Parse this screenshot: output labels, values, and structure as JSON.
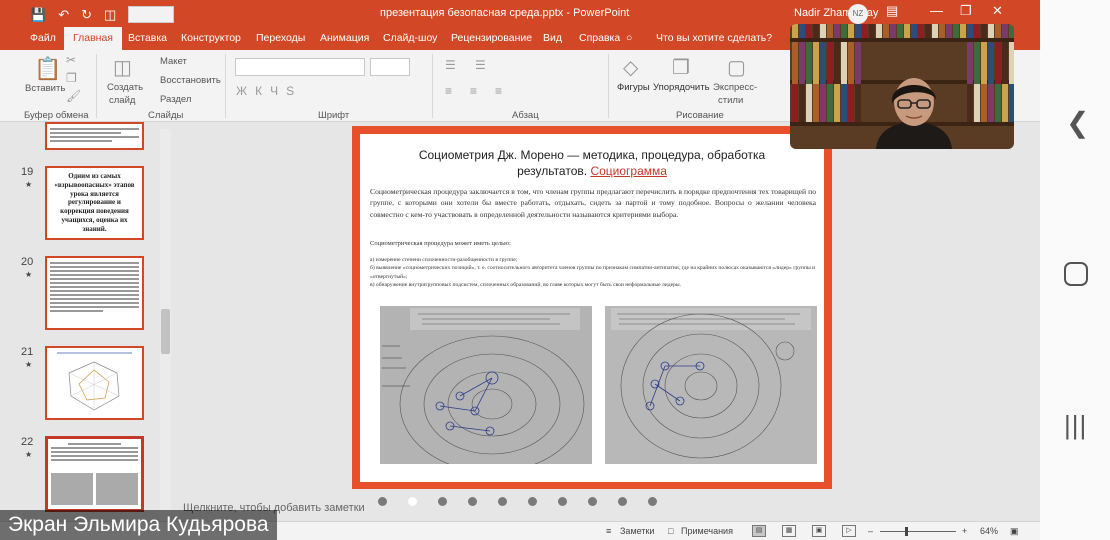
{
  "titlebar": {
    "document_title": "презентация безопасная среда.pptx  -  PowerPoint",
    "user_name": "Nadir Zhamantay",
    "user_initials": "NZ",
    "icons": [
      "save-icon",
      "undo-icon",
      "redo-icon",
      "minimize-icon",
      "restore-icon",
      "close-icon"
    ]
  },
  "tabs": [
    "Файл",
    "Главная",
    "Вставка",
    "Конструктор",
    "Переходы",
    "Анимация",
    "Слайд-шоу",
    "Рецензирование",
    "Вид",
    "Справка"
  ],
  "active_tab": "Главная",
  "tell_me": "Что вы хотите сделать?",
  "ribbon": {
    "paste": "Вставить",
    "clipboard_group": "Буфер обмена",
    "new_slide_line1": "Создать",
    "new_slide_line2": "слайд",
    "layout": "Макет",
    "reset": "Восстановить",
    "section": "Раздел",
    "slides_group": "Слайды",
    "font_group": "Шрифт",
    "font_buttons": [
      "Ж",
      "К",
      "Ч",
      "S"
    ],
    "paragraph_group": "Абзац",
    "shapes": "Фигуры",
    "arrange": "Упорядочить",
    "quick_styles_line1": "Экспресс-",
    "quick_styles_line2": "стили",
    "drawing_group": "Рисование"
  },
  "thumbnails": [
    {
      "number": "",
      "text": ""
    },
    {
      "number": "19",
      "text": "Одним из самых «взрывоопасных» этапов урока является регулирование и коррекция поведения учащихся, оценка их знаний."
    },
    {
      "number": "20",
      "text": ""
    },
    {
      "number": "21",
      "text": ""
    },
    {
      "number": "22",
      "text": ""
    }
  ],
  "slide": {
    "title_line1": "Социометрия Дж. Морено — методика, процедура, обработка",
    "title_line2": "результатов.",
    "title_link": "Социограмма",
    "paragraph": "Социометрическая процедура заключается в том, что членам группы предлагают перечислить в порядке предпочтения тех товарищей по группе, с которыми они хотели бы вместе работать, отдыхать, сидеть за партой и тому подобное. Вопросы о желании человека совместно с кем-то участвовать в определенной деятельности называются критериями выбора.",
    "subheading": "Социометрическая процедура может иметь целью:",
    "list": [
      "а) измерение степени сплоченности-разобщенности в группе;",
      "б) выявление «социометрических позиций», т. е. соотносительного авторитета членов группы по признакам симпатии-антипатии, где на крайних полюсах оказываются «лидер» группы и «отвергнутый»;",
      "в) обнаружение внутригрупповых подсистем, сплоченных образований, во главе которых могут быть свои неформальные лидеры."
    ]
  },
  "dots_count": 10,
  "notes_placeholder": "Щелкните, чтобы добавить заметки",
  "status": {
    "notes": "Заметки",
    "comments": "Примечания",
    "zoom": "64%"
  },
  "caption": "Экран Эльмира Кудьярова"
}
